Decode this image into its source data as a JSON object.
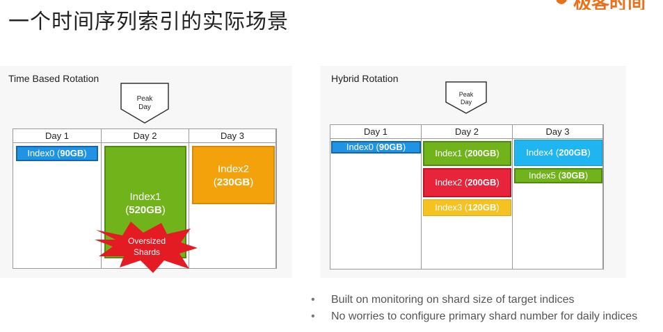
{
  "page": {
    "title": "一个时间序列索引的实际场景",
    "logo_text": "极客时间"
  },
  "left": {
    "title": "Time Based Rotation",
    "peak": [
      "Peak",
      "Day"
    ],
    "days": [
      "Day 1",
      "Day 2",
      "Day 3"
    ],
    "index0": {
      "name": "Index0",
      "size": "90GB"
    },
    "index1": {
      "name": "Index1",
      "size": "520GB"
    },
    "index2": {
      "name": "Index2",
      "size": "230GB"
    },
    "burst": [
      "Oversized",
      "Shards"
    ]
  },
  "right": {
    "title": "Hybrid Rotation",
    "peak": [
      "Peak",
      "Day"
    ],
    "days": [
      "Day 1",
      "Day 2",
      "Day 3"
    ],
    "index0": {
      "name": "Index0",
      "size": "90GB"
    },
    "index1": {
      "name": "Index1",
      "size": "200GB"
    },
    "index2": {
      "name": "Index2",
      "size": "200GB"
    },
    "index3": {
      "name": "Index3",
      "size": "120GB"
    },
    "index4": {
      "name": "Index4",
      "size": "200GB"
    },
    "index5": {
      "name": "Index5",
      "size": "30GB"
    }
  },
  "bullets": [
    "Built on monitoring on shard size of target indices",
    "No worries to configure primary shard number for daily indices"
  ],
  "colors": {
    "blue": "#1f93e4",
    "green": "#70b31a",
    "orange": "#f3a20c",
    "red": "#e8243a",
    "yellow": "#f6c21f",
    "sky": "#1fb5f0",
    "burst": "#e41b23"
  }
}
